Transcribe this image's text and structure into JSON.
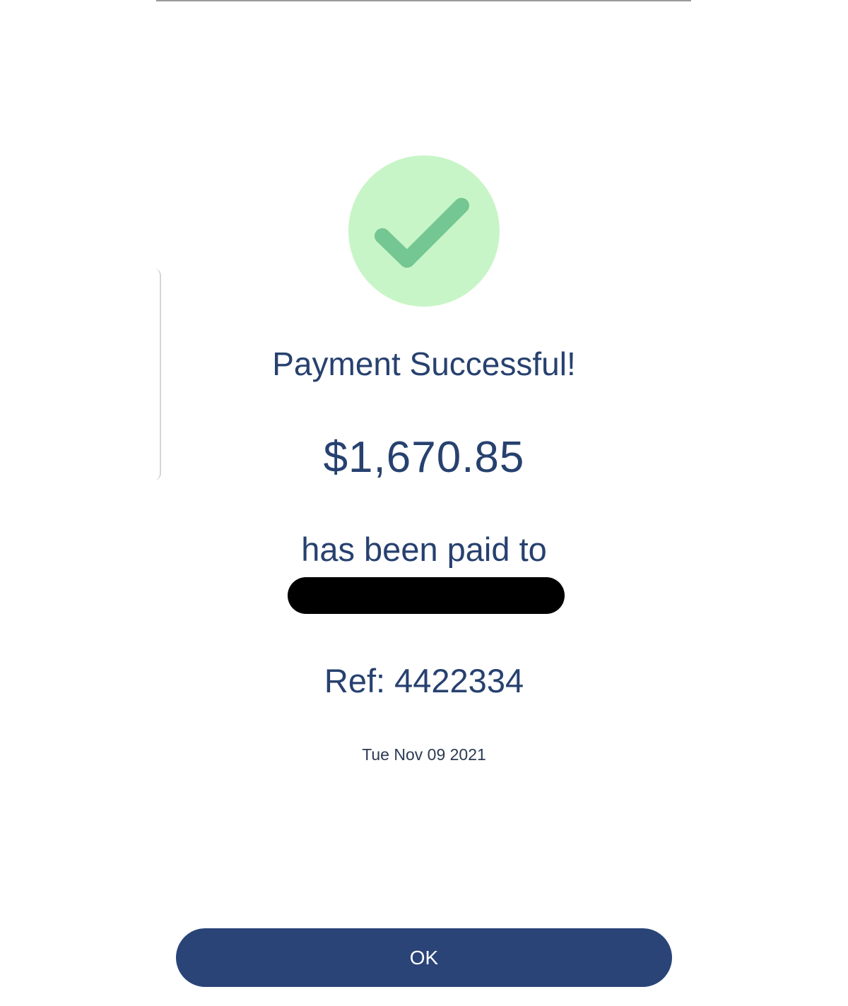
{
  "status": {
    "icon": "checkmark-icon",
    "circle_color": "#c8f5c7",
    "check_color": "#74c693"
  },
  "title": "Payment Successful!",
  "amount": "$1,670.85",
  "paid_to_label": "has been paid to",
  "recipient_redacted": true,
  "reference": "Ref: 4422334",
  "date": "Tue Nov 09 2021",
  "ok_button": {
    "label": "OK",
    "color": "#2a4478"
  },
  "text_color": "#27416f"
}
